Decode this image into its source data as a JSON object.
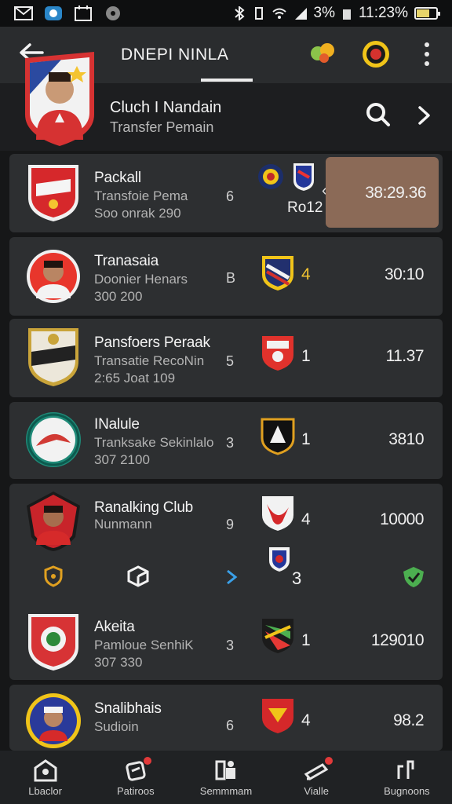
{
  "status_bar": {
    "battery_text": "3%",
    "time": "11:23%"
  },
  "header": {
    "title": "DNEPI NINLA"
  },
  "club": {
    "name": "Cluch I Nandain",
    "subtitle": "Transfer Pemain"
  },
  "rows": [
    {
      "name": "Packall",
      "sub": "Transfoie Pema",
      "sub2": "Soo onrak 290",
      "rank": "6",
      "score": "Ro12",
      "value": "38:29.36",
      "crest_color": "#d6282b"
    },
    {
      "name": "Tranasaia",
      "sub": "Doonier Henars",
      "sub2": "300 200",
      "rank": "B",
      "score": "4",
      "value": "30:10",
      "crest_color": "#e8362c"
    },
    {
      "name": "Pansfoers Peraak",
      "sub": "Transatie RecoNin",
      "sub2": "2:65 Joat 109",
      "rank": "5",
      "score": "1",
      "value": "11.37",
      "crest_color": "#e9e4d6"
    },
    {
      "name": "INalule",
      "sub": "Tranksake Sekinlalo",
      "sub2": "307 2100",
      "rank": "3",
      "score": "1",
      "value": "3810",
      "crest_color": "#1f8a78"
    },
    {
      "name": "Ranalking Club",
      "sub": "Nunmann",
      "sub2": "",
      "rank": "9",
      "score": "4",
      "value": "10000",
      "crest_color": "#c8242a"
    },
    {
      "name": "Akeita",
      "sub": "Pamloue SenhiK",
      "sub2": "307 330",
      "rank": "3",
      "score": "1",
      "value": "129010",
      "crest_color": "#d73335"
    },
    {
      "name": "Snalibhais",
      "sub": "Sudioin",
      "sub2": "",
      "rank": "6",
      "score": "4",
      "value": "98.2",
      "crest_color": "#2a3a9a"
    }
  ],
  "action_row": {
    "score": "3"
  },
  "bottom_nav": [
    {
      "label": "Lbaclor"
    },
    {
      "label": "Patiroos"
    },
    {
      "label": "Semmmam"
    },
    {
      "label": "Vialle"
    },
    {
      "label": "Bugnoons"
    }
  ],
  "colors": {
    "background": "#161718",
    "card": "#2d2f31",
    "highlight": "#8b6a57",
    "accent_gold": "#f2c431"
  }
}
